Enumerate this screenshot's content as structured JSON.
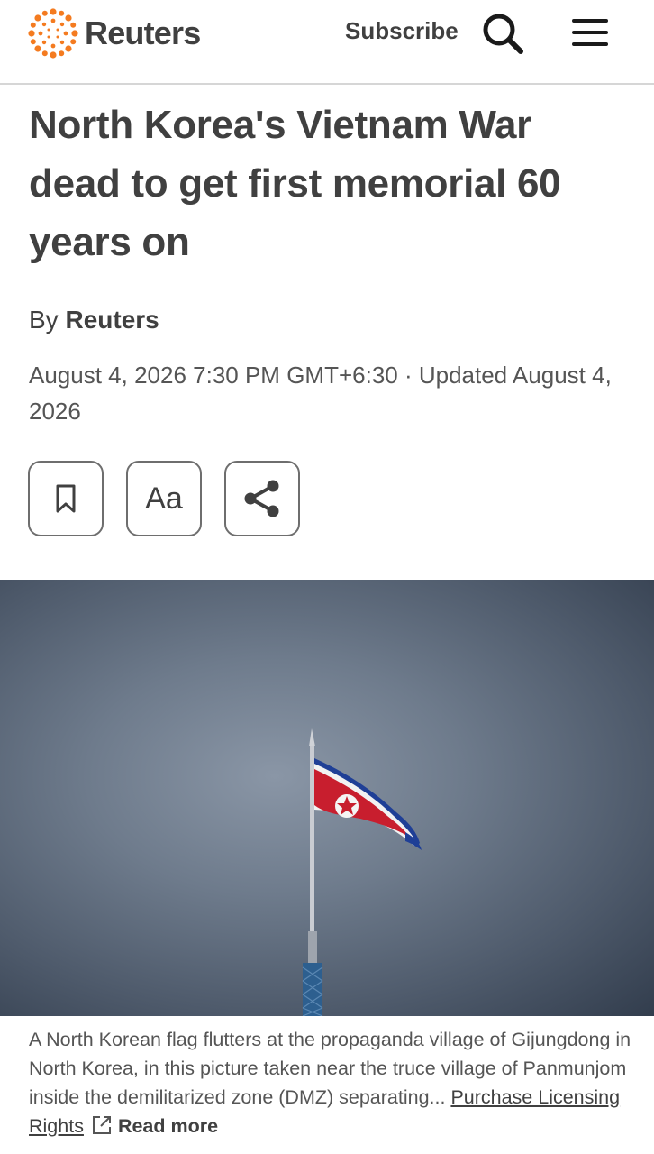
{
  "header": {
    "brand": "Reuters",
    "subscribe_label": "Subscribe",
    "search_icon": "search-icon",
    "menu_icon": "hamburger-menu-icon",
    "brand_color": "#f47b20"
  },
  "article": {
    "headline": "North Korea's Vietnam War dead to get first memorial 60 years on",
    "byline_prefix": "By ",
    "byline_author": "Reuters",
    "dateline": "August 4, 2026 7:30 PM GMT+6:30 · Updated August 4, 2026",
    "actions": {
      "bookmark_icon": "bookmark-icon",
      "font_size_label": "Aa",
      "share_icon": "share-icon"
    },
    "image": {
      "caption": "A North Korean flag flutters at the propaganda village of Gijungdong in North Korea, in this picture taken near the truce village of Panmunjom inside the demilitarized zone (DMZ) separating...",
      "licensing_label": "Purchase Licensing Rights",
      "external_link_icon": "external-link-icon",
      "read_more_label": "Read more"
    }
  }
}
